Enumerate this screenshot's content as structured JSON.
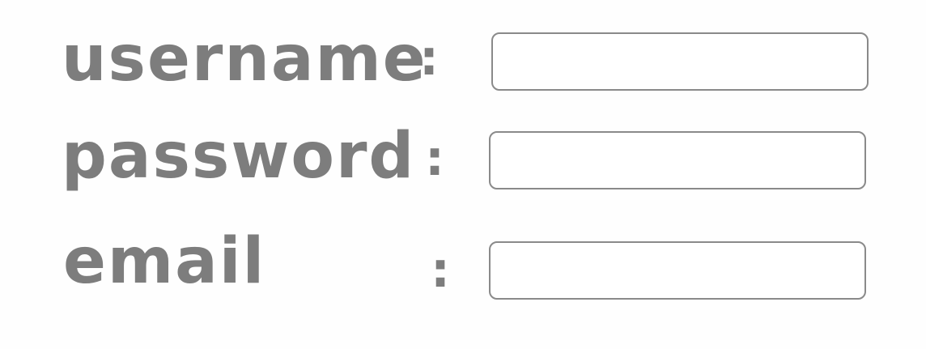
{
  "form": {
    "fields": [
      {
        "label": "username",
        "separator": ":",
        "value": "",
        "placeholder": ""
      },
      {
        "label": "password",
        "separator": ":",
        "value": "",
        "placeholder": ""
      },
      {
        "label": "email",
        "separator": ":",
        "value": "",
        "placeholder": ""
      }
    ]
  },
  "colors": {
    "ink": "#7d7d7d",
    "border": "#8a8a8a",
    "background": "#fefefe"
  }
}
